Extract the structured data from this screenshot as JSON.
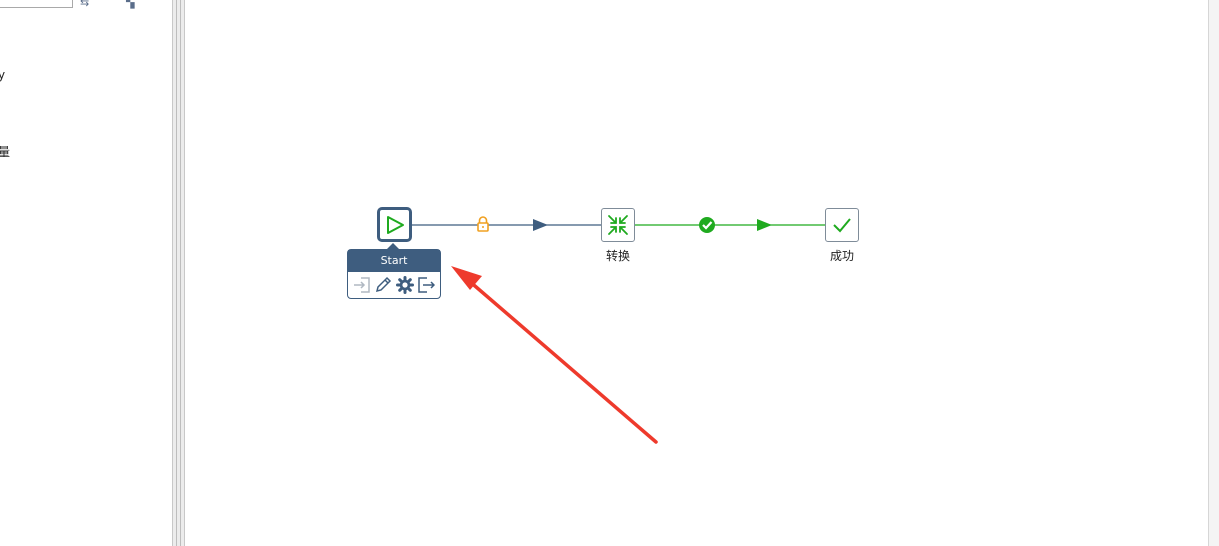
{
  "left_panel": {
    "fragments": [
      "y",
      "量"
    ]
  },
  "canvas": {
    "nodes": [
      {
        "id": "start",
        "label": "Start",
        "icon": "play-icon"
      },
      {
        "id": "transformation",
        "label": "转换",
        "icon": "transformation-icon"
      },
      {
        "id": "success",
        "label": "成功",
        "icon": "checkmark-icon"
      }
    ],
    "hops": [
      {
        "from": "Start",
        "to": "转换",
        "type": "unconditional",
        "icon": "lock-icon",
        "color": "#3e5d7f"
      },
      {
        "from": "转换",
        "to": "成功",
        "type": "success",
        "icon": "check-circle-icon",
        "color": "#1faa1f"
      }
    ],
    "hover_menu": {
      "title": "Start",
      "tools": [
        "input-icon",
        "edit-icon",
        "settings-icon",
        "output-icon"
      ]
    }
  },
  "colors": {
    "node_border": "#3e5d7f",
    "unconditional_hop": "#3e5d7f",
    "success_hop": "#1faa1f",
    "lock": "#f0a020",
    "annotation_arrow": "#ee3a2c"
  }
}
